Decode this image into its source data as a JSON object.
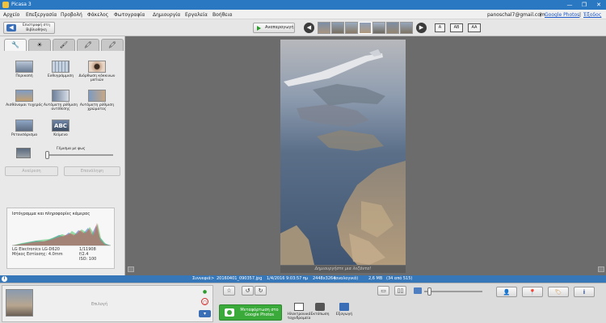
{
  "window": {
    "title": "Picasa 3",
    "minimize": "—",
    "maximize": "❐",
    "close": "✕"
  },
  "menu": {
    "items": [
      "Αρχείο",
      "Επεξεργασία",
      "Προβολή",
      "Φάκελος",
      "Φωτογραφία",
      "Δημιουργία",
      "Εργαλεία",
      "Βοήθεια"
    ],
    "account": "panoschal7@gmail.com",
    "separator": "|",
    "google_photos": "Google Photos",
    "signout": "Έξοδος"
  },
  "toolbar": {
    "back_label": "Επιστροφή στη Βιβλιοθήκη",
    "slideshow_label": "Αναπαραγωγή",
    "zoom_options": [
      "A",
      "AB",
      "AA"
    ]
  },
  "edit_tabs": [
    "🔧",
    "☀",
    "🖌",
    "🖍"
  ],
  "tools": [
    {
      "label": "Περικοπή",
      "icon": "crop-icon"
    },
    {
      "label": "Ευθυγράμμιση",
      "icon": "straighten-icon"
    },
    {
      "label": "Διόρθωση κόκκινων ματιών",
      "icon": "redeye-icon"
    },
    {
      "label": "Αισθάνομαι τυχερός",
      "icon": "lucky-icon"
    },
    {
      "label": "Αυτόματη ρύθμιση αντίθεσης",
      "icon": "contrast-icon"
    },
    {
      "label": "Αυτόματη ρύθμιση χρώματος",
      "icon": "color-icon"
    },
    {
      "label": "Ρετουσάρισμα",
      "icon": "retouch-icon"
    },
    {
      "label": "Κείμενο",
      "icon": "text-icon"
    }
  ],
  "fill_light": {
    "label": "Γέμισμα με φως",
    "value": 0
  },
  "buttons": {
    "undo": "Αναίρεση",
    "redo": "Επανάληψη"
  },
  "histogram": {
    "title": "Ιστόγραμμα και πληροφορίες κάμερας",
    "camera": "LG Electronics LG-D620",
    "focal": "Μήκος Εστίασης: 4.0mm",
    "shutter": "1/11908",
    "aperture": "f/2.4",
    "iso": "ISO: 100"
  },
  "viewer": {
    "caption": "Δημιουργήστε μια λεζάντα!"
  },
  "infostrip": {
    "zoom": "Συννεφιά",
    "filename": "20160401_090357.jpg",
    "datetime": "1/4/2016 9:03:57 πμ",
    "dimensions": "2448x3264",
    "dimensions_note": "(αναλογικά)",
    "size": "2,6 MB",
    "position": "(34 από 515)"
  },
  "tray": {
    "label": "Επιλογή"
  },
  "actions": {
    "share_label": "Μεταφόρτωση στο Google Photos",
    "email": "Ηλεκτρονικό ταχυδρομείο",
    "print": "Εκτύπωση",
    "export": "Εξαγωγή"
  },
  "colors": {
    "titlebar": "#2b78c2",
    "infostrip": "#3577b9",
    "share_green": "#3aaa3a",
    "viewer_bg": "#6c6c6c"
  }
}
